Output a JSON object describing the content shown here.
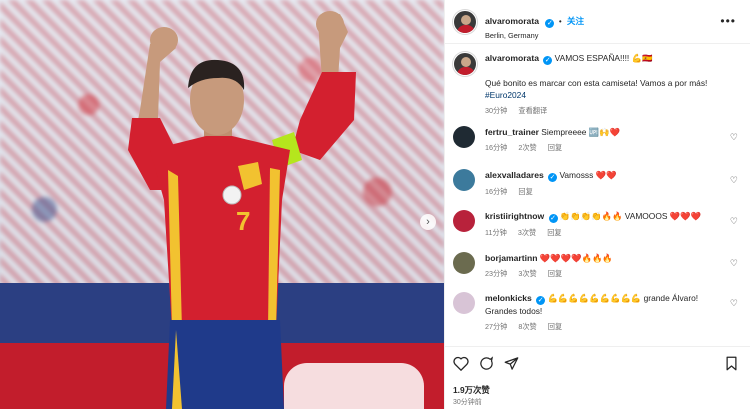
{
  "post": {
    "username": "alvaromorata",
    "follow_label": "关注",
    "location": "Berlin, Germany",
    "more_label": "•••"
  },
  "caption": {
    "username": "alvaromorata",
    "headline": "VAMOS ESPAÑA!!!! 💪🇪🇸",
    "text": "Qué bonito es marcar con esta camiseta! Vamos a por más!",
    "hashtag": "#Euro2024",
    "time": "30分钟",
    "translate": "查看翻译"
  },
  "comments": [
    {
      "username": "fertru_trainer",
      "verified": false,
      "text": "Siempreeee 🆙🙌❤️",
      "time": "16分钟",
      "likes": "2次赞",
      "reply": "回复",
      "avatar_color": "#1f2a33"
    },
    {
      "username": "alexvalladares",
      "verified": true,
      "text": "Vamosss ❤️❤️",
      "time": "16分钟",
      "likes": "",
      "reply": "回复",
      "avatar_color": "#3c7a9c"
    },
    {
      "username": "kristiirightnow",
      "verified": true,
      "text": "👏👏👏👏🔥🔥 VAMOOOS ❤️❤️❤️",
      "time": "11分钟",
      "likes": "3次赞",
      "reply": "回复",
      "avatar_color": "#b8223b"
    },
    {
      "username": "borjamartinn",
      "verified": false,
      "text": "❤️❤️❤️❤️🔥🔥🔥",
      "time": "23分钟",
      "likes": "3次赞",
      "reply": "回复",
      "avatar_color": "#6b6b4f"
    },
    {
      "username": "melonkicks",
      "verified": true,
      "text": "💪💪💪💪💪💪💪💪💪 grande Álvaro! Grandes todos!",
      "time": "27分钟",
      "likes": "8次赞",
      "reply": "回复",
      "avatar_color": "#d8c4d6"
    }
  ],
  "footer": {
    "likes": "1.9万次赞",
    "time": "30分钟前"
  },
  "photo": {
    "jersey_number": "7",
    "jersey_color": "#d3202f",
    "shorts_color": "#1f3a8a",
    "armband_color": "#b5e61d"
  },
  "icons": {
    "like": "heart-icon",
    "comment": "comment-icon",
    "share": "send-icon",
    "save": "bookmark-icon",
    "next": "chevron-right-icon"
  }
}
